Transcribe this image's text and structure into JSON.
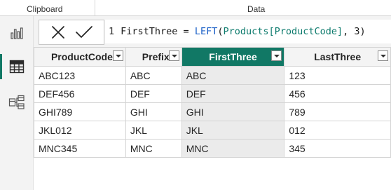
{
  "ribbon": {
    "clipboard_label": "Clipboard",
    "data_label": "Data"
  },
  "rail": {
    "items": [
      "report-view",
      "table-view",
      "model-view"
    ],
    "active": "table-view"
  },
  "formula": {
    "line_number": "1",
    "column_name": "FirstThree",
    "equals": " = ",
    "function": "LEFT",
    "open": "(",
    "table_ref": "Products",
    "column_ref": "[ProductCode]",
    "args_rest": ", 3)"
  },
  "table": {
    "columns": [
      "ProductCode",
      "Prefix",
      "FirstThree",
      "LastThree"
    ],
    "selected_column": "FirstThree",
    "rows": [
      [
        "ABC123",
        "ABC",
        "ABC",
        "123"
      ],
      [
        "DEF456",
        "DEF",
        "DEF",
        "456"
      ],
      [
        "GHI789",
        "GHI",
        "GHI",
        "789"
      ],
      [
        "JKL012",
        "JKL",
        "JKL",
        "012"
      ],
      [
        "MNC345",
        "MNC",
        "MNC",
        "345"
      ]
    ]
  },
  "colors": {
    "accent": "#117865",
    "selected_cells": "#ebebeb",
    "function": "#1b60c7"
  }
}
